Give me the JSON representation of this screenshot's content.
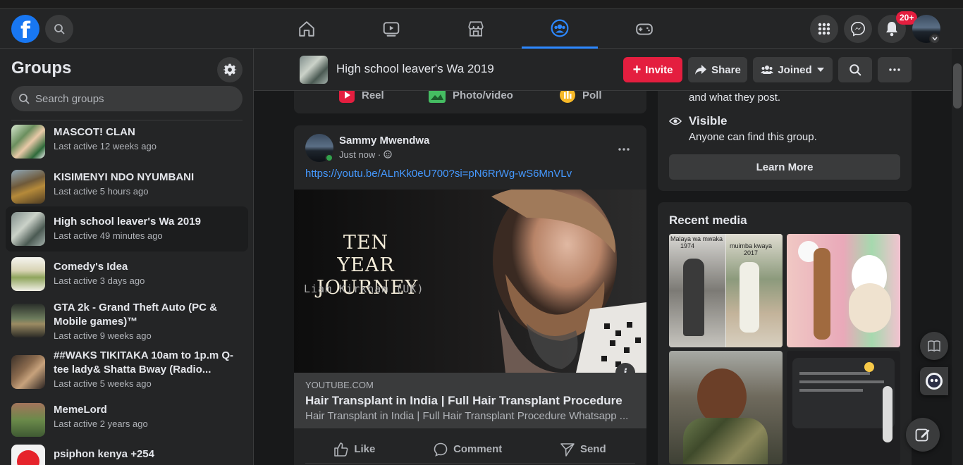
{
  "nav": {
    "tabs": [
      "home",
      "watch",
      "marketplace",
      "groups",
      "gaming"
    ],
    "active_tab": "groups",
    "notifications_badge": "20+"
  },
  "sidebar": {
    "title": "Groups",
    "search_placeholder": "Search groups",
    "items": [
      {
        "name": "MASCOT! CLAN",
        "meta": "Last active 12 weeks ago"
      },
      {
        "name": "KISIMENYI NDO NYUMBANI",
        "meta": "Last active 5 hours ago"
      },
      {
        "name": "High school leaver's Wa 2019",
        "meta": "Last active 49 minutes ago"
      },
      {
        "name": "Comedy's Idea",
        "meta": "Last active 3 days ago"
      },
      {
        "name": "GTA 2k - Grand Theft Auto (PC & Mobile games)™",
        "meta": "Last active 9 weeks ago"
      },
      {
        "name": "##WAKS TIKITAKA 10am to 1p.m Q-tee lady& Shatta Bway (Radio...",
        "meta": "Last active 5 weeks ago"
      },
      {
        "name": "MemeLord",
        "meta": "Last active 2 years ago"
      },
      {
        "name": "psiphon kenya +254",
        "meta": ""
      }
    ]
  },
  "group_header": {
    "title": "High school leaver's Wa 2019",
    "invite": "Invite",
    "share": "Share",
    "joined": "Joined"
  },
  "composer": {
    "reel": "Reel",
    "photo": "Photo/video",
    "poll": "Poll"
  },
  "post": {
    "author": "Sammy Mwendwa",
    "time": "Just now ·",
    "link": "https://youtu.be/ALnKk0eU700?si=pN6RrWg-wS6MnVLv",
    "video_title_line1": "TEN YEAR",
    "video_title_line2": "JOURNEY",
    "video_subtitle": "Liam Kirkham (UK)",
    "domain": "YOUTUBE.COM",
    "link_title": "Hair Transplant in India | Full Hair Transplant Procedure",
    "link_desc": "Hair Transplant in India | Full Hair Transplant Procedure Whatsapp ...",
    "like": "Like",
    "comment": "Comment",
    "send": "Send"
  },
  "about": {
    "text_tail": "and what they post.",
    "visible_title": "Visible",
    "visible_desc": "Anyone can find this group.",
    "learn_more": "Learn More"
  },
  "media": {
    "title": "Recent media",
    "img1_label_a": "Malaya wa mwaka",
    "img1_label_a2": "1974",
    "img1_label_b": "muimba kwaya",
    "img1_label_b2": "2017"
  },
  "colors": {
    "accent": "#2d88ff",
    "invite": "#e41e3f",
    "link": "#4599ff"
  }
}
